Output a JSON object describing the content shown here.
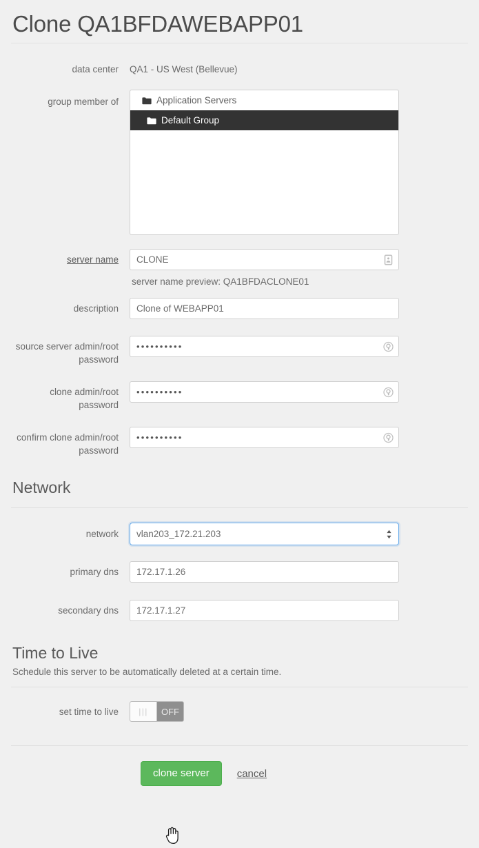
{
  "page": {
    "title": "Clone QA1BFDAWEBAPP01"
  },
  "fields": {
    "data_center": {
      "label": "data center",
      "value": "QA1 - US West (Bellevue)"
    },
    "group_member_of": {
      "label": "group member of",
      "items": [
        {
          "label": "Application Servers",
          "icon": "folder-icon",
          "selected": false
        },
        {
          "label": "Default Group",
          "icon": "folder-icon",
          "selected": true
        }
      ]
    },
    "server_name": {
      "label": "server name",
      "value": "CLONE",
      "placeholder": "",
      "icon": "id-card-icon",
      "preview": "server name preview: QA1BFDACLONE01"
    },
    "description": {
      "label": "description",
      "value": "Clone of WEBAPP01",
      "placeholder": ""
    },
    "source_password": {
      "label": "source server admin/root password",
      "value": "••••••••••",
      "icon": "key-circle-icon"
    },
    "clone_password": {
      "label": "clone admin/root password",
      "value": "••••••••••",
      "icon": "key-circle-icon"
    },
    "confirm_password": {
      "label": "confirm clone admin/root password",
      "value": "••••••••••",
      "icon": "key-circle-icon"
    }
  },
  "network_section": {
    "heading": "Network",
    "network": {
      "label": "network",
      "value": "vlan203_172.21.203",
      "icon": "sort-arrows-icon"
    },
    "primary_dns": {
      "label": "primary dns",
      "value": "172.17.1.26"
    },
    "secondary_dns": {
      "label": "secondary dns",
      "value": "172.17.1.27"
    }
  },
  "ttl_section": {
    "heading": "Time to Live",
    "subtitle": "Schedule this server to be automatically deleted at a certain time.",
    "toggle": {
      "label": "set time to live",
      "state_label": "OFF",
      "handle_glyph": "|||",
      "on": false
    }
  },
  "footer": {
    "submit_label": "clone server",
    "cancel_label": "cancel"
  },
  "colors": {
    "background": "#f0f0f0",
    "primary_button": "#5cb85c",
    "selected_row": "#333333",
    "focus_border": "#62a8ea",
    "text": "#6a6a6a"
  },
  "cursor": {
    "type": "pointer-hand-cursor"
  }
}
